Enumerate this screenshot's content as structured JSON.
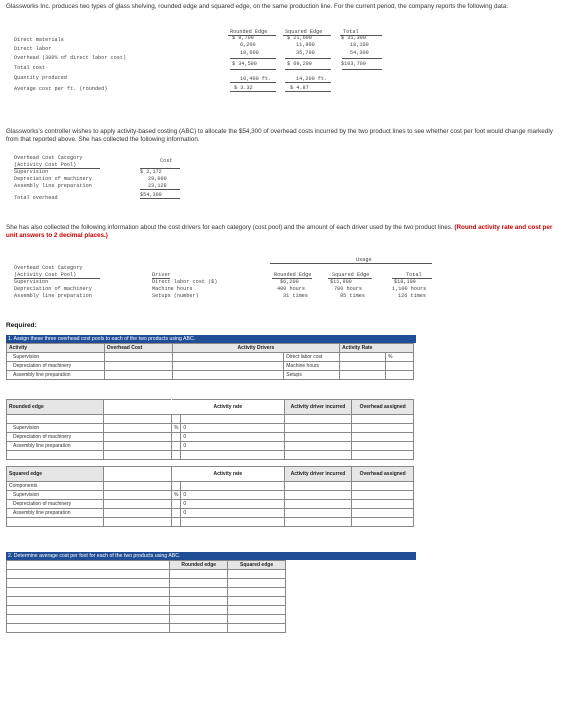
{
  "intro": {
    "text": "Glassworks Inc. produces two types of glass shelving, rounded edge and squared edge, on the same production line. For the current period, the company reports the following data."
  },
  "cost_table": {
    "headers": [
      "Rounded Edge",
      "Squared Edge",
      "Total"
    ],
    "rows": [
      {
        "label": "Direct materials",
        "values": [
          "$ 9,700",
          "$ 21,600",
          "$ 31,300"
        ]
      },
      {
        "label": "Direct labor",
        "values": [
          "6,200",
          "11,900",
          "18,100"
        ]
      },
      {
        "label": "Overhead (300% of direct labor cost)",
        "values": [
          "18,600",
          "35,700",
          "54,300"
        ]
      },
      {
        "label": "Total cost",
        "values": [
          "$ 34,500",
          "$ 69,200",
          "$103,700"
        ]
      },
      {
        "label": "Quantity produced",
        "values": [
          "10,400 ft.",
          "14,200 ft.",
          ""
        ]
      },
      {
        "label": "Average cost per ft. (rounded)",
        "values": [
          "$ 3.32",
          "$ 4.87",
          ""
        ]
      }
    ]
  },
  "controller": {
    "text": "Glassworks's controller wishes to apply activity-based costing (ABC) to allocate the $54,300 of overhead costs incurred by the two product lines to see whether cost per foot would change markedly from that reported above. She has collected the following information."
  },
  "overhead_table": {
    "header1": "Overhead Cost Category",
    "header2": "(Activity Cost Pool)",
    "cost_header": "Cost",
    "rows": [
      {
        "label": "Supervision",
        "value": "$ 2,172"
      },
      {
        "label": "Depreciation of machinery",
        "value": "29,000"
      },
      {
        "label": "Assembly line preparation",
        "value": "23,128"
      }
    ],
    "total_label": "Total overhead",
    "total_value": "$54,300"
  },
  "drivers_intro": {
    "text": "She has also collected the following information about the cost drivers for each category (cost pool) and the amount of each driver used by the two product lines.",
    "instruction": "(Round activity rate and cost per unit answers to 2 decimal places.)"
  },
  "drivers_table": {
    "usage_label": "Usage",
    "header1": "Overhead Cost Category",
    "header2": "(Activity Cost Pool)",
    "driver_header": "Driver",
    "col_headers": [
      "Rounded Edge",
      "Squared Edge",
      "Total"
    ],
    "rows": [
      {
        "label": "Supervision",
        "driver": "Direct labor cost ($)",
        "values": [
          "$6,200",
          "$11,900",
          "$18,100"
        ]
      },
      {
        "label": "Depreciation of machinery",
        "driver": "Machine hours",
        "values": [
          "400 hours",
          "700 hours",
          "1,100 hours"
        ]
      },
      {
        "label": "Assembly line preparation",
        "driver": "Setups (number)",
        "values": [
          "31 times",
          "95 times",
          "126 times"
        ]
      }
    ]
  },
  "required": {
    "label": "Required:",
    "part1": "1. Assign these three overhead cost pools to each of the two products using ABC.",
    "part2": "2. Determine average cost per foot for each of the two products using ABC."
  },
  "abc_grid": {
    "h_activity": "Activity",
    "h_overhead_cost": "Overhead Cost",
    "h_activity_drivers": "Activity Drivers",
    "h_activity_rate": "Activity Rate",
    "activities": [
      "Supervision",
      "Depreciation of machinery",
      "Assembly line preparation"
    ],
    "drivers": [
      "Direct labor cost",
      "Machine hours",
      "Setups"
    ],
    "percent_sign": "%",
    "rounded_title": "Rounded edge",
    "squared_title": "Squared edge",
    "components_label": "Components",
    "h_rate": "Activity rate",
    "h_driver_incurred": "Activity driver incurred",
    "h_overhead_assigned": "Overhead assigned",
    "zero": "0"
  },
  "part2_grid": {
    "col_headers": [
      "Rounded edge",
      "Squared edge"
    ]
  }
}
